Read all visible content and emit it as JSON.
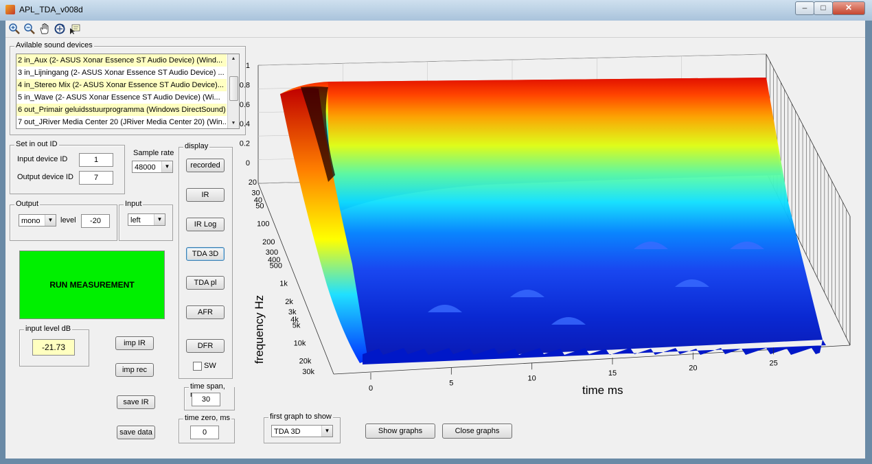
{
  "window": {
    "title": "APL_TDA_v008d",
    "minimize_glyph": "–",
    "maximize_glyph": "□",
    "close_glyph": "✕"
  },
  "toolbar": {
    "tools": [
      "zoom-in-icon",
      "zoom-out-icon",
      "pan-hand-icon",
      "rotate-3d-icon",
      "data-cursor-icon"
    ]
  },
  "devices": {
    "legend": "Avilable sound devices",
    "items": [
      {
        "label": "2 in_Aux (2- ASUS Xonar Essence ST Audio Device) (Wind...",
        "highlighted": true
      },
      {
        "label": "3 in_Lijningang (2- ASUS Xonar Essence ST Audio Device) ...",
        "highlighted": false
      },
      {
        "label": "4 in_Stereo Mix (2- ASUS Xonar Essence ST Audio Device)...",
        "highlighted": true
      },
      {
        "label": "5 in_Wave (2- ASUS Xonar Essence ST Audio Device) (Wi...",
        "highlighted": false
      },
      {
        "label": "6 out_Primair geluidsstuurprogramma (Windows DirectSound)",
        "highlighted": true
      },
      {
        "label": "7 out_JRiver Media Center 20 (JRiver Media Center 20) (Win...",
        "highlighted": false
      }
    ]
  },
  "inout": {
    "legend": "Set in out ID",
    "input_label": "Input device ID",
    "input_value": "1",
    "output_label": "Output device ID",
    "output_value": "7"
  },
  "sample_rate": {
    "label": "Sample rate",
    "value": "48000"
  },
  "output": {
    "legend": "Output",
    "mode": "mono",
    "level_label": "level",
    "level_value": "-20"
  },
  "input": {
    "legend": "Input",
    "channel": "left"
  },
  "run_button": "RUN MEASUREMENT",
  "input_level": {
    "legend": "input level dB",
    "value": "-21.73"
  },
  "actions": {
    "imp_ir": "imp IR",
    "imp_rec": "imp rec",
    "save_ir": "save IR",
    "save_data": "save data"
  },
  "display": {
    "legend": "display",
    "buttons": [
      "recorded",
      "IR",
      "IR Log",
      "TDA 3D",
      "TDA pl",
      "AFR",
      "DFR"
    ],
    "selected": "TDA 3D",
    "sw_label": "SW"
  },
  "time_span": {
    "legend": "time span, ms",
    "value": "30"
  },
  "time_zero": {
    "legend": "time zero, ms",
    "value": "0"
  },
  "first_graph": {
    "legend": "first graph to show",
    "value": "TDA 3D"
  },
  "graph_buttons": {
    "show": "Show graphs",
    "close": "Close graphs"
  },
  "chart_data": {
    "type": "surface",
    "title": "",
    "xlabel": "time   ms",
    "ylabel": "frequency    Hz",
    "zlabel": "",
    "z_ticks": [
      "1",
      "0.8",
      "0.6",
      "0.4",
      "0.2",
      "0"
    ],
    "frequency_ticks": [
      "20",
      "30",
      "40",
      "50",
      "100",
      "200",
      "300",
      "400",
      "500",
      "1k",
      "2k",
      "3k",
      "4k",
      "5k",
      "10k",
      "20k",
      "30k"
    ],
    "time_ticks": [
      "0",
      "5",
      "10",
      "15",
      "20",
      "25"
    ],
    "x_range_ms": [
      0,
      30
    ],
    "y_range_hz": [
      20,
      30000
    ],
    "y_scale": "log",
    "z_range": [
      0,
      1
    ],
    "colormap": "jet",
    "grid": true
  },
  "colors": {
    "run_button": "#00f000",
    "level_box": "#ffffc0",
    "highlight_row": "#ffffc2"
  }
}
